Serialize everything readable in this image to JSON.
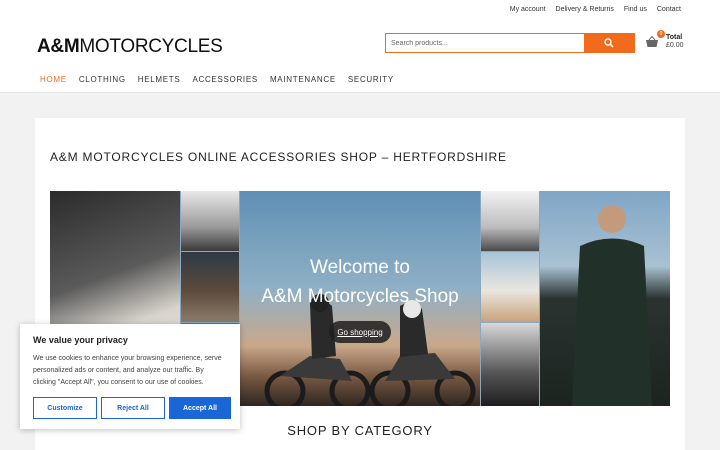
{
  "top_links": [
    "My account",
    "Delivery & Returns",
    "Find us",
    "Contact"
  ],
  "logo": {
    "bold": "A&M",
    "light": "MOTORCYCLES"
  },
  "search": {
    "placeholder": "Search products..."
  },
  "cart": {
    "title": "Total",
    "amount": "£0.00",
    "count": "0"
  },
  "nav": {
    "items": [
      "HOME",
      "CLOTHING",
      "HELMETS",
      "ACCESSORIES",
      "MAINTENANCE",
      "SECURITY"
    ],
    "active": 0
  },
  "page_title": "A&M MOTORCYCLES ONLINE ACCESSORIES SHOP – HERTFORDSHIRE",
  "hero": {
    "line1": "Welcome to",
    "line2": "A&M Motorcycles Shop",
    "button": "Go shopping"
  },
  "shop_by_category": "SHOP BY CATEGORY",
  "cookie": {
    "title": "We value your privacy",
    "text": "We use cookies to enhance your browsing experience, serve personalized ads or content, and analyze our traffic. By clicking \"Accept All\", you consent to our use of cookies.",
    "customize": "Customize",
    "reject": "Reject All",
    "accept": "Accept All"
  },
  "colors": {
    "accent": "#f26b1d",
    "cookie_blue": "#1a66d6"
  }
}
